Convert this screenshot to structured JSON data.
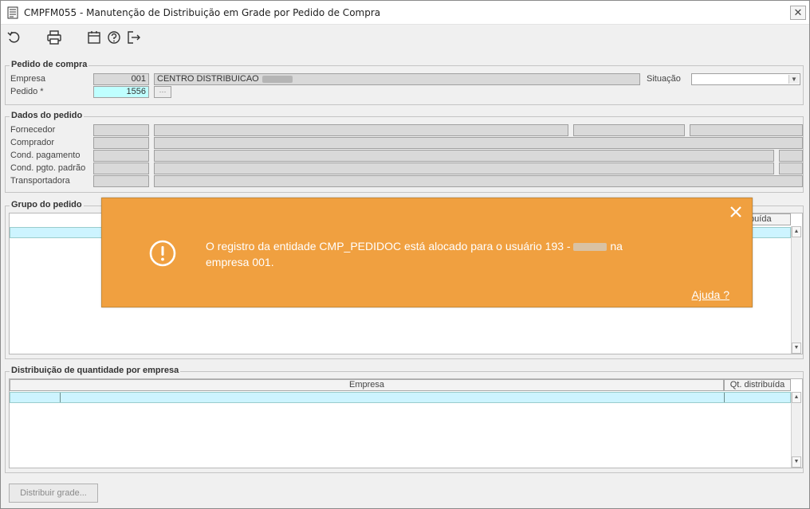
{
  "window": {
    "title": "CMPFM055 - Manutenção de Distribuição em Grade por Pedido de Compra",
    "close_glyph": "✕"
  },
  "toolbar": {
    "icons": [
      "refresh-icon",
      "print-icon",
      "calendar-icon",
      "help-icon",
      "exit-icon"
    ]
  },
  "pedido_compra": {
    "legend": "Pedido de compra",
    "empresa_label": "Empresa",
    "empresa_code": "001",
    "empresa_name": "CENTRO DISTRIBUICAO",
    "pedido_label": "Pedido *",
    "pedido_value": "1556",
    "situacao_label": "Situação",
    "situacao_value": ""
  },
  "dados_pedido": {
    "legend": "Dados do pedido",
    "labels": [
      "Fornecedor",
      "Comprador",
      "Cond. pagamento",
      "Cond. pgto. padrão",
      "Transportadora"
    ]
  },
  "grupo_pedido": {
    "legend": "Grupo do pedido",
    "col_qt": "stribuída"
  },
  "distribuicao": {
    "legend": "Distribuição de quantidade por empresa",
    "col_empresa": "Empresa",
    "col_qt": "Qt. distribuída"
  },
  "footer": {
    "distribuir_label": "Distribuir grade..."
  },
  "toast": {
    "message_part1": "O registro da entidade CMP_PEDIDOC está alocado para o usuário 193 -",
    "message_part2": "na empresa 001.",
    "help_link": "Ajuda ?",
    "color": "#f0a040"
  },
  "colors": {
    "highlight_row": "#cdf4ff",
    "required_field": "#bfffff"
  }
}
